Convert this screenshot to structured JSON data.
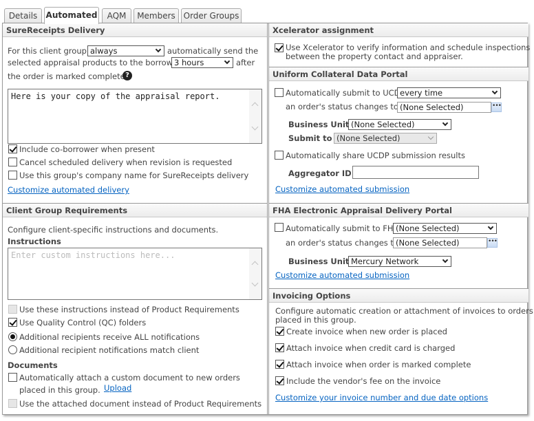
{
  "tabs": [
    {
      "label": "Details",
      "active": false
    },
    {
      "label": "Automated",
      "active": true
    },
    {
      "label": "AQM",
      "active": false
    },
    {
      "label": "Members",
      "active": false
    },
    {
      "label": "Order Groups",
      "active": false
    }
  ],
  "surereceipts": {
    "title": "SureReceipts Delivery",
    "text_1": "For this client group,",
    "frequency_select": "always",
    "text_2": "automatically send the",
    "text_3": "selected appraisal products to the borrower",
    "delay_select": "3 hours",
    "text_4": "after",
    "text_5": "the order is marked complete.",
    "help_icon": "?",
    "message": "Here is your copy of the appraisal report.",
    "options": [
      {
        "label": "Include co-borrower when present",
        "checked": true
      },
      {
        "label": "Cancel scheduled delivery when revision is requested",
        "checked": false
      },
      {
        "label": "Use this group's company name for SureReceipts delivery",
        "checked": false
      }
    ],
    "link": "Customize automated delivery"
  },
  "requirements": {
    "title": "Client Group Requirements",
    "intro": "Configure client-specific instructions and documents.",
    "instructions_label": "Instructions",
    "instructions_placeholder": "Enter custom instructions here...",
    "use_instructions": {
      "label": "Use these instructions instead of Product Requirements",
      "checked": false,
      "disabled": true
    },
    "use_qc": {
      "label": "Use Quality Control (QC) folders",
      "checked": true
    },
    "radio_all": {
      "label": "Additional recipients receive ALL notifications",
      "selected": true
    },
    "radio_match": {
      "label": "Additional recipient notifications match client",
      "selected": false
    },
    "documents_label": "Documents",
    "attach_doc": {
      "label_1": "Automatically attach a custom document to new orders",
      "label_2": "placed in this group.",
      "checked": false
    },
    "upload_link": "Upload",
    "use_attached": {
      "label": "Use the attached document instead of Product Requirements",
      "checked": false,
      "disabled": true
    }
  },
  "xcelerator": {
    "title": "Xcelerator assignment",
    "option": {
      "label_1": "Use Xcelerator to verify information and schedule inspections",
      "label_2": "between the property contact and appraiser.",
      "checked": true
    }
  },
  "ucdp": {
    "title": "Uniform Collateral Data Portal",
    "auto_submit": {
      "label": "Automatically submit to UCDP",
      "checked": false
    },
    "frequency_select": "every time",
    "status_label": "an order's status changes to",
    "status_value": "(None Selected)",
    "business_unit_label": "Business Unit",
    "business_unit_value": "(None Selected)",
    "submit_to_label": "Submit to",
    "submit_to_value": "(None Selected)",
    "share_results": {
      "label": "Automatically share UCDP submission results",
      "checked": false
    },
    "aggregator_label": "Aggregator ID",
    "aggregator_value": "",
    "link": "Customize automated submission"
  },
  "fha": {
    "title": "FHA Electronic Appraisal Delivery Portal",
    "auto_submit": {
      "label": "Automatically submit to FHA",
      "checked": false
    },
    "frequency_select": "(None Selected)",
    "status_label": "an order's status changes to",
    "status_value": "(None Selected)",
    "business_unit_label": "Business Unit",
    "business_unit_value": "Mercury Network",
    "link": "Customize automated submission"
  },
  "invoicing": {
    "title": "Invoicing Options",
    "intro_1": "Configure automatic creation or attachment of invoices to orders",
    "intro_2": "placed in this group.",
    "options": [
      {
        "label": "Create invoice when new order is placed",
        "checked": true
      },
      {
        "label": "Attach invoice when credit card is charged",
        "checked": true
      },
      {
        "label": "Attach invoice when order is marked complete",
        "checked": true
      },
      {
        "label": "Include the vendor's fee on the invoice",
        "checked": true
      }
    ],
    "link": "Customize your invoice number and due date options"
  }
}
